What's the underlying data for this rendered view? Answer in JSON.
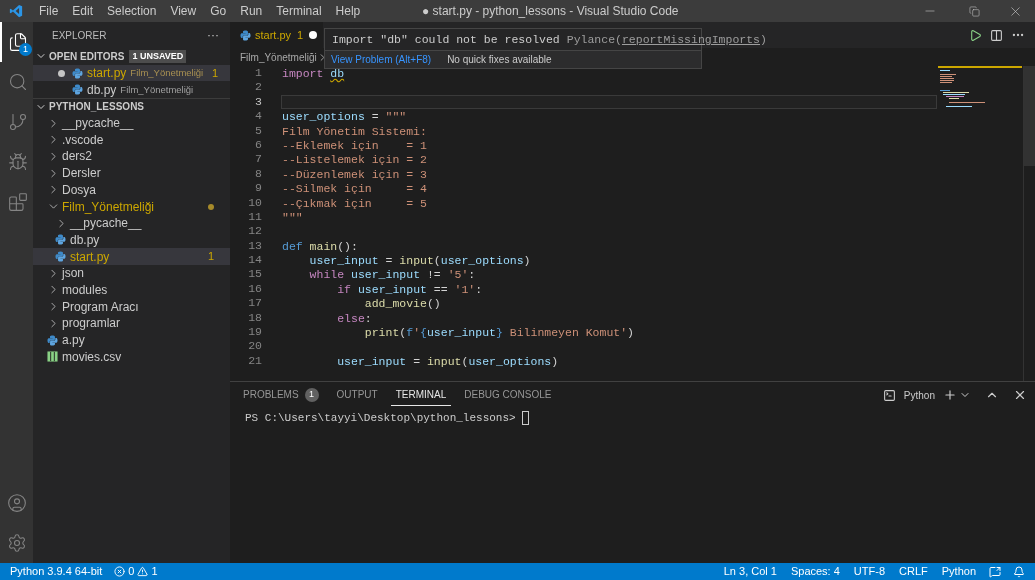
{
  "title_bar": {
    "menus": [
      "File",
      "Edit",
      "Selection",
      "View",
      "Go",
      "Run",
      "Terminal",
      "Help"
    ],
    "title": "● start.py - python_lessons - Visual Studio Code"
  },
  "activity_bar": {
    "items": [
      {
        "kind": "files",
        "selected": true,
        "badge": "1"
      },
      {
        "kind": "search",
        "selected": false
      },
      {
        "kind": "source-control",
        "selected": false
      },
      {
        "kind": "run",
        "selected": false
      },
      {
        "kind": "extensions",
        "selected": false
      }
    ],
    "bottom": [
      {
        "kind": "account"
      },
      {
        "kind": "settings"
      }
    ]
  },
  "sidebar": {
    "title": "EXPLORER",
    "more": "···",
    "open_editors": {
      "title": "OPEN EDITORS",
      "expanded": true,
      "badge": "1 UNSAVED",
      "items": [
        {
          "name": "start.py",
          "folder": "Film_Yönetmeliği",
          "badge": "1",
          "modified": true,
          "problem": true,
          "selected": true
        },
        {
          "name": "db.py",
          "folder": "Film_Yönetmeliği",
          "modified": false,
          "problem": false,
          "selected": false
        }
      ]
    },
    "workspace": {
      "title": "PYTHON_LESSONS",
      "expanded": true,
      "items": [
        {
          "name": "__pycache__",
          "kind": "folder",
          "expanded": false,
          "problem": false,
          "selected": false
        },
        {
          "name": ".vscode",
          "kind": "folder",
          "expanded": false,
          "problem": false,
          "selected": false
        },
        {
          "name": "ders2",
          "kind": "folder",
          "expanded": false,
          "problem": false,
          "selected": false
        },
        {
          "name": "Dersler",
          "kind": "folder",
          "expanded": false,
          "problem": false,
          "selected": false
        },
        {
          "name": "Dosya",
          "kind": "folder",
          "expanded": false,
          "problem": false,
          "selected": false
        },
        {
          "name": "Film_Yönetmeliği",
          "kind": "folder",
          "expanded": true,
          "problem": true,
          "selected": false,
          "children": [
            {
              "name": "__pycache__",
              "kind": "folder",
              "expanded": false,
              "problem": false,
              "selected": false
            },
            {
              "name": "db.py",
              "kind": "python",
              "problem": false,
              "selected": false
            },
            {
              "name": "start.py",
              "kind": "python",
              "badge": "1",
              "problem": true,
              "selected": true
            }
          ]
        },
        {
          "name": "json",
          "kind": "folder",
          "expanded": false,
          "problem": false,
          "selected": false
        },
        {
          "name": "modules",
          "kind": "folder",
          "expanded": false,
          "problem": false,
          "selected": false
        },
        {
          "name": "Program Aracı",
          "kind": "folder",
          "expanded": false,
          "problem": false,
          "selected": false
        },
        {
          "name": "programlar",
          "kind": "folder",
          "expanded": false,
          "problem": false,
          "selected": false
        },
        {
          "name": "a.py",
          "kind": "python",
          "problem": false,
          "selected": false
        },
        {
          "name": "movies.csv",
          "kind": "csv",
          "problem": false,
          "selected": false
        }
      ]
    }
  },
  "editor": {
    "tabs": [
      {
        "name": "start.py",
        "badge": "1",
        "modified": true,
        "selected": true
      }
    ],
    "breadcrumb": [
      "Film_Yönetmeliği"
    ],
    "hover": {
      "message": "Import \"db\" could not be resolved",
      "source": "Pylance(",
      "code": "reportMissingImports",
      "source_end": ")",
      "actions": [
        "View Problem (Alt+F8)",
        "No quick fixes available"
      ]
    },
    "lines": [
      {
        "n": "1",
        "current": false,
        "tokens": [
          {
            "t": "import ",
            "kind": "kw"
          },
          {
            "t": "db",
            "kind": "unresolved"
          }
        ]
      },
      {
        "n": "2",
        "current": false
      },
      {
        "n": "3",
        "current": true
      },
      {
        "n": "4",
        "current": false,
        "tokens": [
          {
            "t": "user_options",
            "kind": "var"
          },
          {
            "t": " = ",
            "kind": "op"
          },
          {
            "t": "\"\"\"",
            "kind": "str"
          }
        ]
      },
      {
        "n": "5",
        "current": false,
        "tokens": [
          {
            "t": "Film Yönetim Sistemi:",
            "kind": "str"
          }
        ]
      },
      {
        "n": "6",
        "current": false,
        "tokens": [
          {
            "t": "--Eklemek için    = 1",
            "kind": "str"
          }
        ]
      },
      {
        "n": "7",
        "current": false,
        "tokens": [
          {
            "t": "--Listelemek için = 2",
            "kind": "str"
          }
        ]
      },
      {
        "n": "8",
        "current": false,
        "tokens": [
          {
            "t": "--Düzenlemek için = 3",
            "kind": "str"
          }
        ]
      },
      {
        "n": "9",
        "current": false,
        "tokens": [
          {
            "t": "--Silmek için     = 4",
            "kind": "str"
          }
        ]
      },
      {
        "n": "10",
        "current": false,
        "tokens": [
          {
            "t": "--Çıkmak için     = 5",
            "kind": "str"
          }
        ]
      },
      {
        "n": "11",
        "current": false,
        "tokens": [
          {
            "t": "\"\"\"",
            "kind": "str"
          }
        ]
      },
      {
        "n": "12",
        "current": false
      },
      {
        "n": "13",
        "current": false,
        "tokens": [
          {
            "t": "def ",
            "kind": "storage"
          },
          {
            "t": "main",
            "kind": "fn"
          },
          {
            "t": "():",
            "kind": "op"
          }
        ]
      },
      {
        "n": "14",
        "current": false,
        "tokens": [
          {
            "t": "    user_input",
            "kind": "var"
          },
          {
            "t": " = ",
            "kind": "op"
          },
          {
            "t": "input",
            "kind": "fn"
          },
          {
            "t": "(",
            "kind": "op"
          },
          {
            "t": "user_options",
            "kind": "var"
          },
          {
            "t": ")",
            "kind": "op"
          }
        ]
      },
      {
        "n": "15",
        "current": false,
        "tokens": [
          {
            "t": "    while ",
            "kind": "kw"
          },
          {
            "t": "user_input",
            "kind": "var"
          },
          {
            "t": " != ",
            "kind": "op"
          },
          {
            "t": "'5'",
            "kind": "str"
          },
          {
            "t": ":",
            "kind": "op"
          }
        ]
      },
      {
        "n": "16",
        "current": false,
        "tokens": [
          {
            "t": "        if ",
            "kind": "kw"
          },
          {
            "t": "user_input",
            "kind": "var"
          },
          {
            "t": " == ",
            "kind": "op"
          },
          {
            "t": "'1'",
            "kind": "str"
          },
          {
            "t": ":",
            "kind": "op"
          }
        ]
      },
      {
        "n": "17",
        "current": false,
        "tokens": [
          {
            "t": "            add_movie",
            "kind": "fn"
          },
          {
            "t": "()",
            "kind": "op"
          }
        ]
      },
      {
        "n": "18",
        "current": false,
        "tokens": [
          {
            "t": "        else",
            "kind": "kw"
          },
          {
            "t": ":",
            "kind": "op"
          }
        ]
      },
      {
        "n": "19",
        "current": false,
        "tokens": [
          {
            "t": "            print",
            "kind": "fn"
          },
          {
            "t": "(",
            "kind": "op"
          },
          {
            "t": "f",
            "kind": "storage"
          },
          {
            "t": "'",
            "kind": "str"
          },
          {
            "t": "{",
            "kind": "storage"
          },
          {
            "t": "user_input",
            "kind": "var"
          },
          {
            "t": "}",
            "kind": "storage"
          },
          {
            "t": " Bilinmeyen Komut'",
            "kind": "str"
          },
          {
            "t": ")",
            "kind": "op"
          }
        ]
      },
      {
        "n": "20",
        "current": false
      },
      {
        "n": "21",
        "current": false,
        "tokens": [
          {
            "t": "        user_input",
            "kind": "var"
          },
          {
            "t": " = ",
            "kind": "op"
          },
          {
            "t": "input",
            "kind": "fn"
          },
          {
            "t": "(",
            "kind": "op"
          },
          {
            "t": "user_options",
            "kind": "var"
          },
          {
            "t": ")",
            "kind": "op"
          }
        ]
      }
    ]
  },
  "panel": {
    "tabs": [
      {
        "label": "PROBLEMS",
        "badge": "1",
        "selected": false
      },
      {
        "label": "OUTPUT",
        "selected": false
      },
      {
        "label": "TERMINAL",
        "selected": true
      },
      {
        "label": "DEBUG CONSOLE",
        "selected": false
      }
    ],
    "terminal_profile": "Python",
    "prompt": "PS C:\\Users\\tayyi\\Desktop\\python_lessons>"
  },
  "status_bar": {
    "interpreter": "Python 3.9.4 64-bit",
    "errors": "0",
    "warnings": "1",
    "right": [
      "Ln 3, Col 1",
      "Spaces: 4",
      "UTF-8",
      "CRLF",
      "Python"
    ]
  }
}
